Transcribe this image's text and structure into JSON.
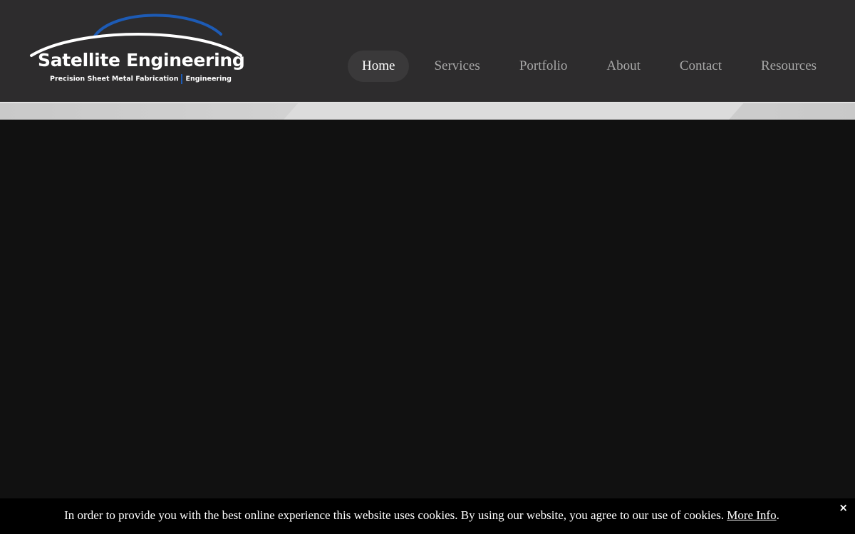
{
  "logo": {
    "title": "Satellite Engineering",
    "tagline_left": "Precision Sheet Metal Fabrication",
    "tagline_right": "Engineering"
  },
  "nav": {
    "items": [
      {
        "label": "Home",
        "active": true
      },
      {
        "label": "Services"
      },
      {
        "label": "Portfolio"
      },
      {
        "label": "About"
      },
      {
        "label": "Contact"
      },
      {
        "label": "Resources"
      }
    ]
  },
  "cookie": {
    "message": "In order to provide you with the best online experience this website uses cookies. By using our website, you agree to our use of cookies.",
    "link_label": "More Info",
    "trailing": ".",
    "close_label": "×"
  },
  "colors": {
    "header_bg": "#2d2c2d",
    "page_bg": "#111111",
    "nav_active_bg": "#3a393a",
    "logo_arc_blue": "#1d5bb5",
    "cookie_bg": "#000000"
  }
}
